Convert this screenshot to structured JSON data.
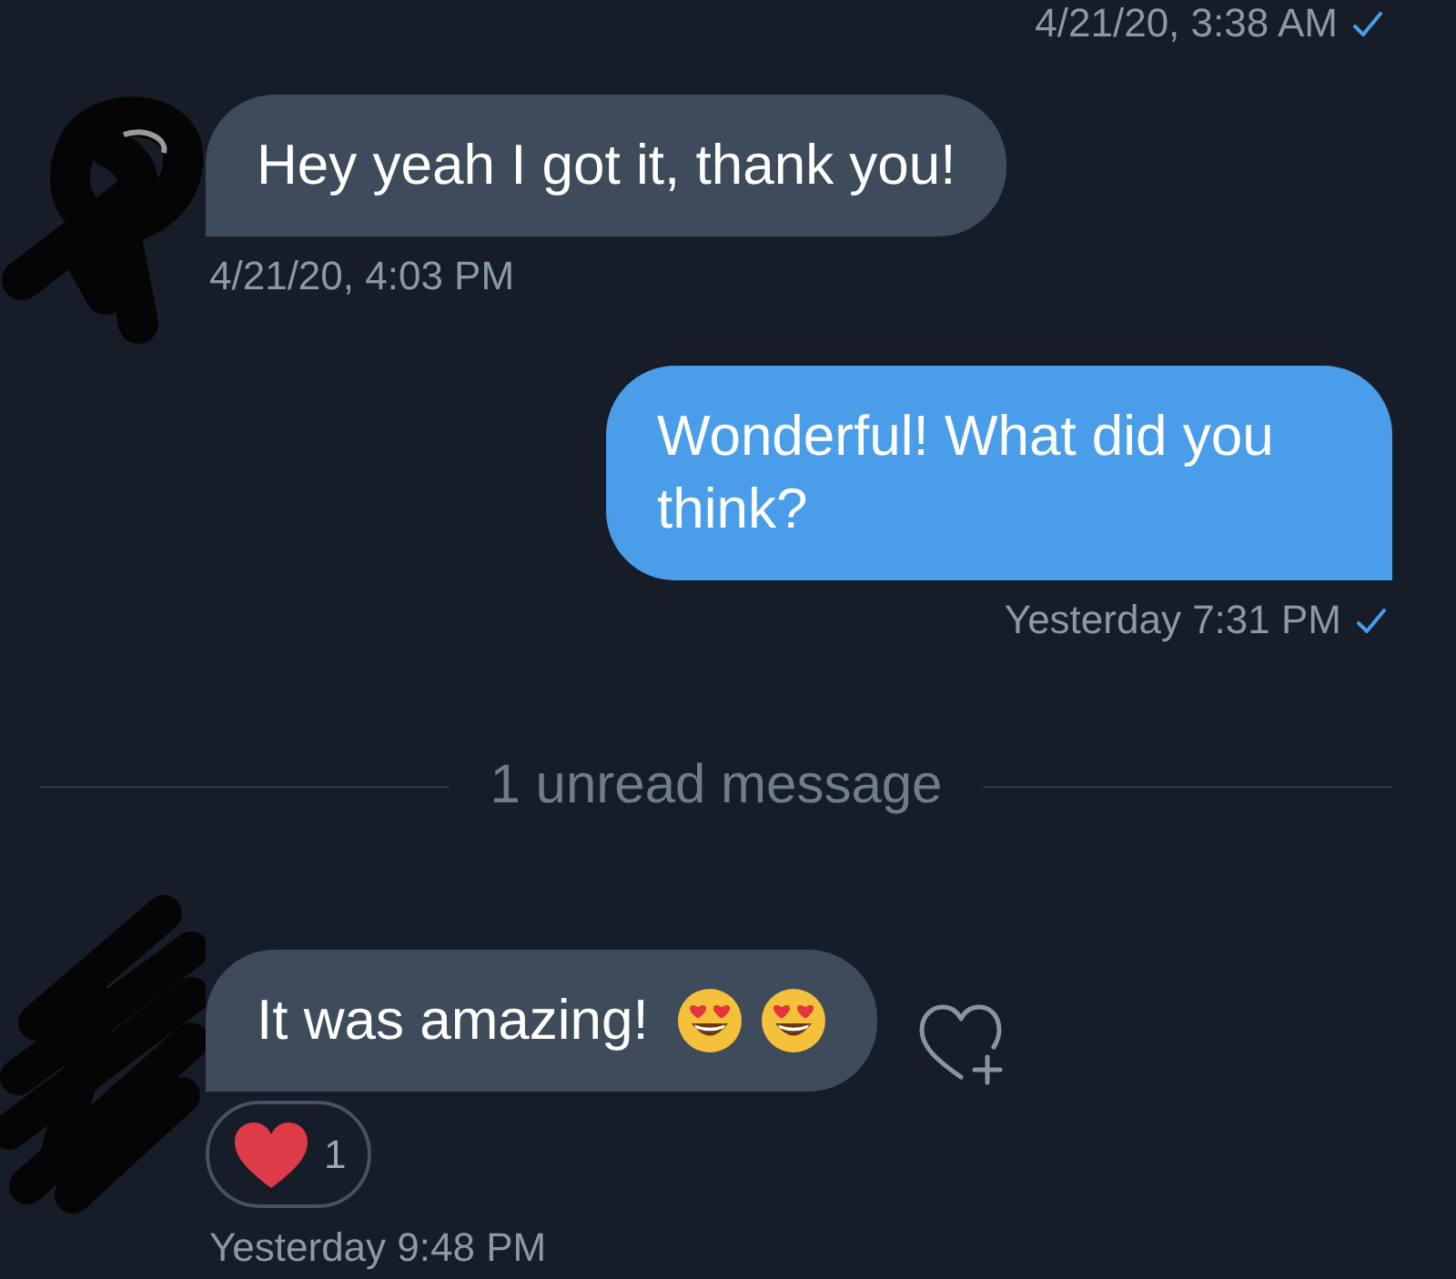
{
  "conversation": [
    {
      "kind": "sent_receipt",
      "time": "4/21/20, 3:38 AM",
      "read": true
    },
    {
      "kind": "received_message",
      "text": "Hey yeah I got it, thank you!",
      "time": "4/21/20, 4:03 PM"
    },
    {
      "kind": "sent_message",
      "text": "Wonderful! What did you think?",
      "time": "Yesterday 7:31 PM",
      "read": true
    },
    {
      "kind": "divider",
      "text": "1 unread message"
    },
    {
      "kind": "received_message",
      "text": "It was amazing!",
      "emojis": [
        {
          "kind": "heart_eyes"
        },
        {
          "kind": "heart_eyes"
        }
      ],
      "add_reaction": true,
      "reactions": [
        {
          "kind": "heart",
          "count": "1"
        }
      ],
      "time": "Yesterday 9:48 PM"
    }
  ]
}
